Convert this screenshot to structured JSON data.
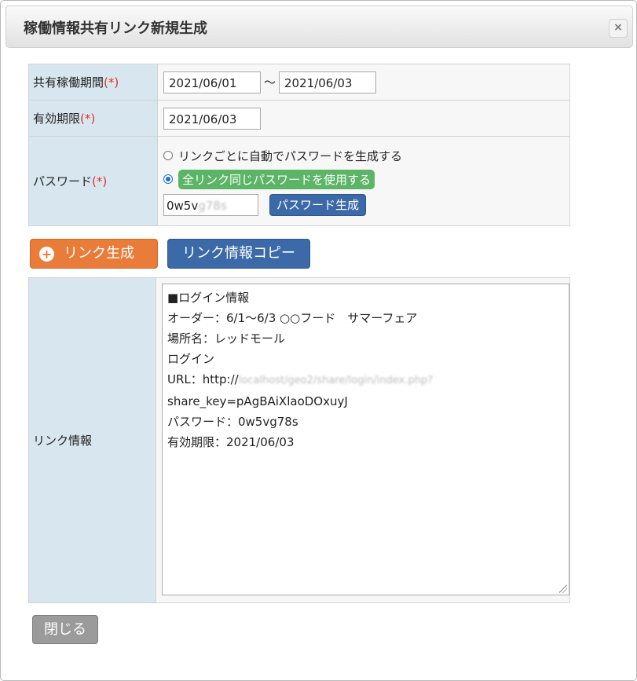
{
  "dialog": {
    "title": "稼働情報共有リンク新規生成",
    "close_glyph": "×"
  },
  "form": {
    "period": {
      "label": "共有稼働期間",
      "required_mark": "(*)",
      "start": "2021/06/01",
      "separator": "～",
      "end": "2021/06/03"
    },
    "expiry": {
      "label": "有効期限",
      "required_mark": "(*)",
      "value": "2021/06/03"
    },
    "password": {
      "label": "パスワード",
      "required_mark": "(*)",
      "option_auto": "リンクごとに自動でパスワードを生成する",
      "option_same": "全リンク同じパスワードを使用する",
      "selected_option": "option_same",
      "value_visible": "0w5v",
      "value_blurred": "g78s",
      "generate_button": "パスワード生成"
    }
  },
  "actions": {
    "generate_link": "リンク生成",
    "copy_link_info": "リンク情報コピー"
  },
  "link_info": {
    "label": "リンク情報",
    "lines": {
      "l1": "■ログイン情報",
      "l2": "オーダー：6/1～6/3 ○○フード　サマーフェア",
      "l3": "場所名：レッドモール",
      "l4": "ログイン",
      "l5_prefix": "URL：http://",
      "l5_blurred": "localhost/geo2/share/login/index.php?",
      "l6": "share_key=pAgBAiXlaoDOxuyJ",
      "l7": "パスワード：0w5vg78s",
      "l8": "有効期限：2021/06/03"
    }
  },
  "footer": {
    "close_button": "閉じる"
  }
}
